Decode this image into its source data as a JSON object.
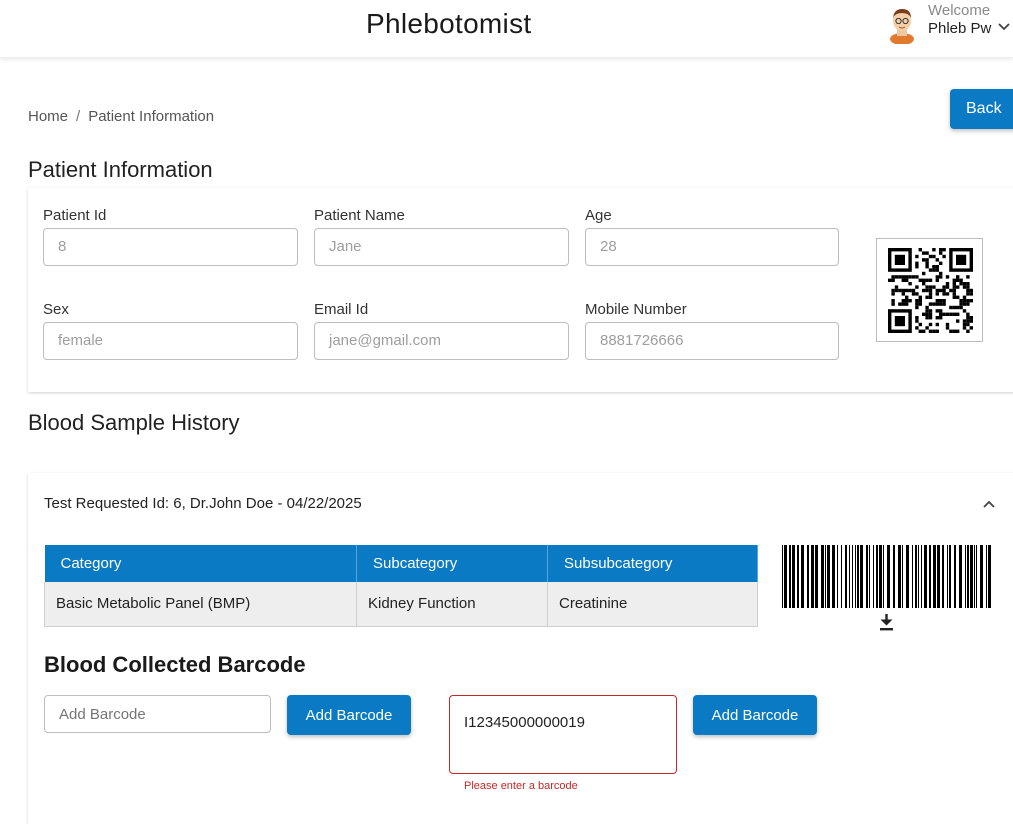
{
  "header": {
    "title": "Phlebotomist",
    "welcome": "Welcome",
    "user_name": "Phleb Pw"
  },
  "breadcrumb": {
    "home": "Home",
    "separator": "/",
    "current": "Patient Information"
  },
  "back_label": "Back",
  "patient_section": {
    "title": "Patient Information",
    "fields": {
      "patient_id": {
        "label": "Patient Id",
        "placeholder": "8"
      },
      "patient_name": {
        "label": "Patient Name",
        "placeholder": "Jane"
      },
      "age": {
        "label": "Age",
        "placeholder": "28"
      },
      "sex": {
        "label": "Sex",
        "placeholder": "female"
      },
      "email": {
        "label": "Email Id",
        "placeholder": "jane@gmail.com"
      },
      "mobile": {
        "label": "Mobile Number",
        "placeholder": "8881726666"
      }
    }
  },
  "history": {
    "title": "Blood Sample History",
    "request_text": "Test Requested Id: 6, Dr.John Doe - 04/22/2025",
    "table": {
      "headers": [
        "Category",
        "Subcategory",
        "Subsubcategory"
      ],
      "rows": [
        [
          "Basic Metabolic Panel (BMP)",
          "Kidney Function",
          "Creatinine"
        ]
      ]
    }
  },
  "barcode_section": {
    "title": "Blood Collected Barcode",
    "input_placeholder": "Add Barcode",
    "add_label": "Add Barcode",
    "input2_value": "I12345000000019",
    "add_label_2": "Add Barcode",
    "error": "Please enter a barcode"
  },
  "colors": {
    "primary": "#0a7ac4",
    "error": "#c62828"
  },
  "icons": [
    "avatar",
    "chevron-down-icon",
    "chevron-up-icon",
    "qr-code-icon",
    "barcode-icon",
    "download-icon"
  ]
}
